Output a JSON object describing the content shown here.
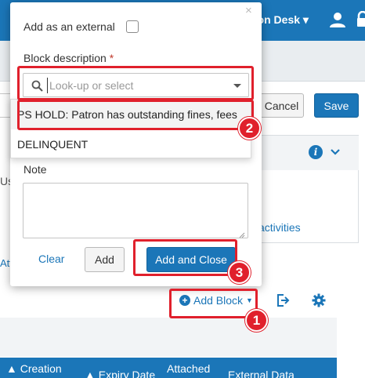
{
  "topbar": {
    "desk_label": "tion Desk ▾"
  },
  "toolbar": {
    "cancel_label": "Cancel",
    "save_label": "Save"
  },
  "info_panel": {
    "activities_link": "activities"
  },
  "fragments": {
    "use": "Use",
    "att": "Att"
  },
  "blocks": {
    "add_block_label": "Add Block"
  },
  "table": {
    "headers": [
      "Creation",
      "Expiry Date",
      "Attached",
      "External Data"
    ]
  },
  "dialog": {
    "external_label": "Add as an external",
    "external_checked": false,
    "block_description_label": "Block description",
    "required_marker": "*",
    "search_placeholder": "Look-up or select",
    "search_value": "",
    "options": [
      "PS HOLD: Patron has outstanding fines, fees",
      "DELINQUENT"
    ],
    "note_label": "Note",
    "note_value": "",
    "clear_label": "Clear",
    "add_label": "Add",
    "add_close_label": "Add and Close"
  },
  "annotations": {
    "color": "#e0202c",
    "badges": [
      "1",
      "2",
      "3"
    ]
  },
  "colors": {
    "primary": "#1b76b8",
    "annotation": "#e0202c"
  },
  "icons": [
    "user-icon",
    "lock-icon",
    "info-icon",
    "chevron-down-icon",
    "plus-circle-icon",
    "export-icon",
    "gear-icon",
    "close-icon",
    "search-icon",
    "dropdown-caret-icon"
  ]
}
